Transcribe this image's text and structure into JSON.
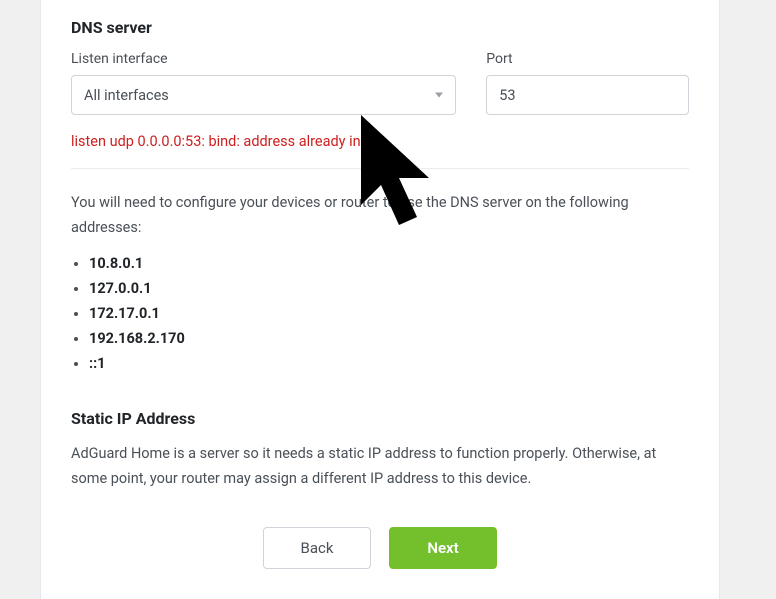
{
  "dns": {
    "title": "DNS server",
    "interface_label": "Listen interface",
    "interface_value": "All interfaces",
    "port_label": "Port",
    "port_value": "53",
    "error": "listen udp 0.0.0.0:53: bind: address already in use",
    "help": "You will need to configure your devices or router to use the DNS server on the following addresses:",
    "addresses": [
      "10.8.0.1",
      "127.0.0.1",
      "172.17.0.1",
      "192.168.2.170",
      "::1"
    ]
  },
  "static_ip": {
    "title": "Static IP Address",
    "text": "AdGuard Home is a server so it needs a static IP address to function properly. Otherwise, at some point, your router may assign a different IP address to this device."
  },
  "buttons": {
    "back": "Back",
    "next": "Next"
  }
}
